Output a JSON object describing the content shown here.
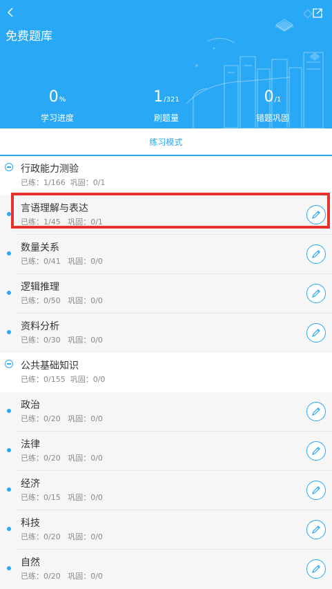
{
  "header": {
    "title": "免费题库",
    "bg_color": "#29a8f5",
    "back_icon": "chevron-left-icon",
    "share_icon": "share-icon"
  },
  "stats": [
    {
      "value": "0",
      "unit": "%",
      "label": "学习进度"
    },
    {
      "value": "1",
      "unit": "/321",
      "label": "刷题量"
    },
    {
      "value": "0",
      "unit": "/1",
      "label": "错题巩固"
    }
  ],
  "mode_tab": {
    "label": "练习模式"
  },
  "sections": [
    {
      "name": "行政能力测验",
      "meta": "已练：1/166  巩固：0/1",
      "items": [
        {
          "name": "言语理解与表达",
          "meta": "已练：1/45   巩固：0/1"
        },
        {
          "name": "数量关系",
          "meta": "已练：0/41   巩固：0/0"
        },
        {
          "name": "逻辑推理",
          "meta": "已练：0/50   巩固：0/0"
        },
        {
          "name": "资料分析",
          "meta": "已练：0/30   巩固：0/0"
        }
      ]
    },
    {
      "name": "公共基础知识",
      "meta": "已练：0/155  巩固：0/0",
      "items": [
        {
          "name": "政治",
          "meta": "已练：0/20   巩固：0/0"
        },
        {
          "name": "法律",
          "meta": "已练：0/20   巩固：0/0"
        },
        {
          "name": "经济",
          "meta": "已练：0/15   巩固：0/0"
        },
        {
          "name": "科技",
          "meta": "已练：0/20   巩固：0/0"
        },
        {
          "name": "自然",
          "meta": "已练：0/20   巩固：0/0"
        }
      ]
    }
  ],
  "accent_color": "#29a8f5",
  "highlight_color": "#e5322d"
}
